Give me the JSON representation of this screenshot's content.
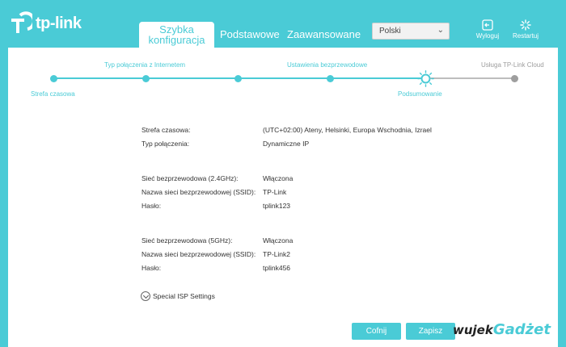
{
  "brand": {
    "logo_text": "tp-link"
  },
  "nav": {
    "tabs": [
      {
        "label_line1": "Szybka",
        "label_line2": "konfiguracja"
      },
      {
        "label": "Podstawowe"
      },
      {
        "label": "Zaawansowane"
      }
    ],
    "language": {
      "selected": "Polski"
    },
    "logout_label": "Wyloguj",
    "reboot_label": "Restartuj"
  },
  "steps": {
    "labels": [
      "Strefa czasowa",
      "Typ połączenia z Internetem",
      "Ustawienia bezprzewodowe",
      "Podsumowanie",
      "Usługa TP-Link Cloud"
    ]
  },
  "summary": {
    "timezone": {
      "label": "Strefa czasowa:",
      "value": "(UTC+02:00) Ateny, Helsinki, Europa Wschodnia, Izrael"
    },
    "connection": {
      "label": "Typ połączenia:",
      "value": "Dynamiczne IP"
    },
    "wifi24": {
      "state_label": "Sieć bezprzewodowa (2.4GHz):",
      "state_value": "Włączona",
      "ssid_label": "Nazwa sieci bezprzewodowej (SSID):",
      "ssid_value": "TP-Link",
      "pass_label": "Hasło:",
      "pass_value": "tplink123"
    },
    "wifi5": {
      "state_label": "Sieć bezprzewodowa (5GHz):",
      "state_value": "Włączona",
      "ssid_label": "Nazwa sieci bezprzewodowej (SSID):",
      "ssid_value": "TP-Link2",
      "pass_label": "Hasło:",
      "pass_value": "tplink456"
    }
  },
  "isp_settings_label": "Special ISP Settings",
  "buttons": {
    "back": "Cofnij",
    "save": "Zapisz"
  },
  "watermark": {
    "part1": "wujek",
    "part2": "Gadżet"
  },
  "colors": {
    "accent": "#4acbd6",
    "inactive": "#9e9e9e"
  }
}
